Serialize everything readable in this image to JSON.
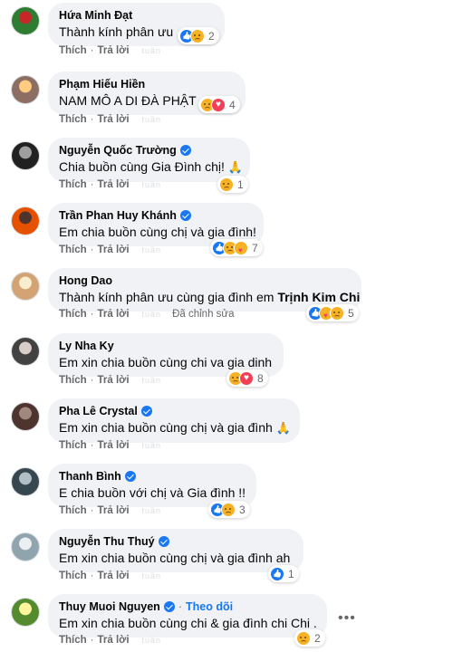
{
  "comments": [
    {
      "author": "Hứa Minh Đạt",
      "verified": false,
      "text": "Thành kính phân ưu",
      "reactions": [
        "like",
        "sad"
      ],
      "reaction_count": "2",
      "like_label": "Thích",
      "reply_label": "Trả lời",
      "time": "tuần"
    },
    {
      "author": "Phạm Hiếu Hiền",
      "verified": false,
      "text": "NAM MÔ A DI ĐÀ PHẬT",
      "reactions": [
        "sad",
        "love"
      ],
      "reaction_count": "4",
      "like_label": "Thích",
      "reply_label": "Trả lời",
      "time": "tuần"
    },
    {
      "author": "Nguyễn Quốc Trường",
      "verified": true,
      "text": "Chia buồn cùng Gia Đình chị!",
      "emoji": "🙏",
      "reactions": [
        "sad"
      ],
      "reaction_count": "1",
      "like_label": "Thích",
      "reply_label": "Trả lời",
      "time": "tuần"
    },
    {
      "author": "Trần Phan Huy Khánh",
      "verified": true,
      "text": "Em chia buồn cùng chị và gia đình!",
      "reactions": [
        "like",
        "sad",
        "care"
      ],
      "reaction_count": "7",
      "like_label": "Thích",
      "reply_label": "Trả lời",
      "time": "tuần"
    },
    {
      "author": "Hong Dao",
      "verified": false,
      "text": "Thành kính phân ưu cùng gia đình em",
      "tag": "Trịnh Kim Chi",
      "reactions": [
        "like",
        "care",
        "sad"
      ],
      "reaction_count": "5",
      "like_label": "Thích",
      "reply_label": "Trả lời",
      "time": "tuần",
      "edited": "Đã chỉnh sửa"
    },
    {
      "author": "Ly Nha Ky",
      "verified": false,
      "text": "Em xin chia buồn cùng chi va gia dinh",
      "reactions": [
        "sad",
        "love"
      ],
      "reaction_count": "8",
      "like_label": "Thích",
      "reply_label": "Trả lời",
      "time": "tuần"
    },
    {
      "author": "Pha Lê Crystal",
      "verified": true,
      "text": "Em xin chia buồn cùng chị và gia đình",
      "emoji": "🙏",
      "reactions": [],
      "reaction_count": "",
      "like_label": "Thích",
      "reply_label": "Trả lời",
      "time": "tuần"
    },
    {
      "author": "Thanh Bình",
      "verified": true,
      "text": "E chia buồn với chị và Gia đình !!",
      "reactions": [
        "like",
        "sad"
      ],
      "reaction_count": "3",
      "like_label": "Thích",
      "reply_label": "Trả lời",
      "time": "tuần"
    },
    {
      "author": "Nguyễn Thu Thuý",
      "verified": true,
      "text": "Em xin chia buồn cùng chị và gia đình ah",
      "reactions": [
        "like"
      ],
      "reaction_count": "1",
      "like_label": "Thích",
      "reply_label": "Trả lời",
      "time": "tuần"
    },
    {
      "author": "Thuy Muoi Nguyen",
      "verified": true,
      "follow": "Theo dõi",
      "text": "Em xin chia buồn cùng chi & gia đình chi Chi .",
      "reactions": [
        "sad"
      ],
      "reaction_count": "2",
      "like_label": "Thích",
      "reply_label": "Trả lời",
      "time": "tuần",
      "more": "•••"
    }
  ],
  "separator": "·",
  "colors": {
    "bubble": "#f0f2f5",
    "link": "#1877f2",
    "meta": "#65676b",
    "like": "#1877f2",
    "sad": "#f7b125",
    "love": "#f33e58"
  }
}
